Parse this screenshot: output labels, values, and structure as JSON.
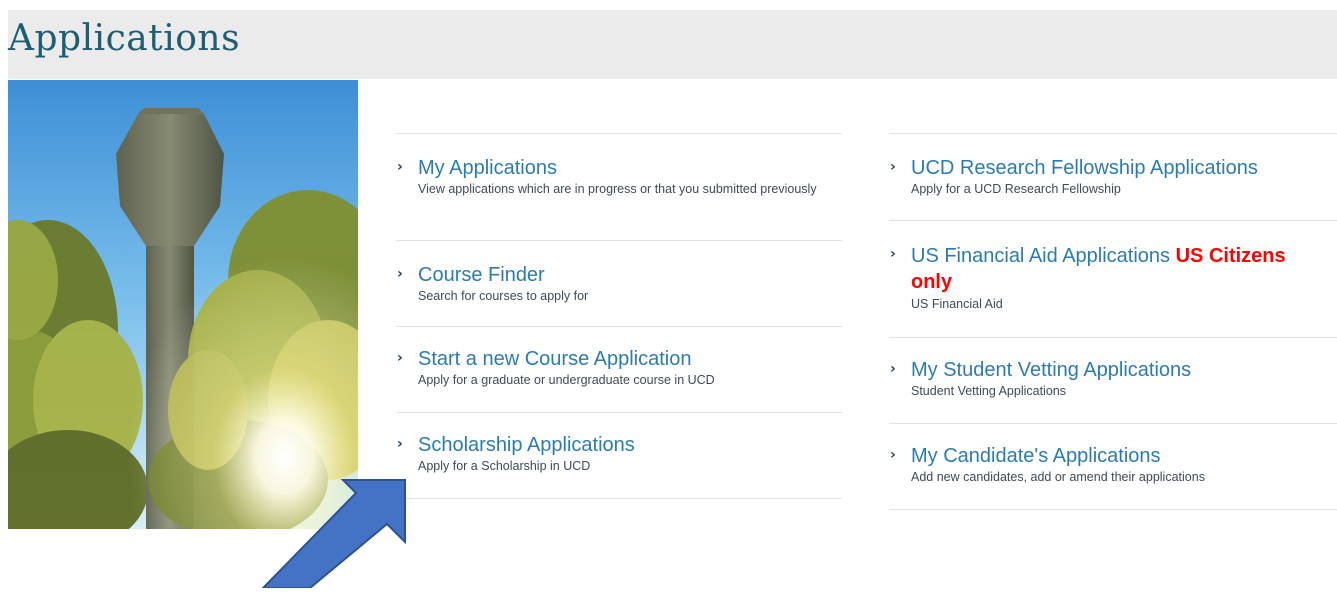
{
  "page": {
    "title": "Applications"
  },
  "left_links": [
    {
      "title": "My Applications",
      "description": "View applications which are in progress or that you submitted previously"
    },
    {
      "title": "Course Finder",
      "description": "Search for courses to apply for"
    },
    {
      "title": "Start a new Course Application",
      "description": "Apply for a graduate or undergraduate course in UCD"
    },
    {
      "title": "Scholarship Applications",
      "description": "Apply for a Scholarship in UCD"
    }
  ],
  "right_links": [
    {
      "title": "UCD Research Fellowship Applications",
      "description": "Apply for a UCD Research Fellowship"
    },
    {
      "title": "US Financial Aid Applications",
      "title_highlight": "US Citizens only",
      "description": "US Financial Aid"
    },
    {
      "title": "My Student Vetting Applications",
      "description": "Student Vetting Applications"
    },
    {
      "title": "My Candidate's Applications",
      "description": "Add new candidates, add or amend their applications"
    }
  ],
  "icons": {
    "link_chevron": "chevron-right-icon",
    "annotation": "arrow-pointer-icon"
  },
  "colors": {
    "header_bg": "#ebebeb",
    "title": "#1e5e74",
    "link": "#2c7bb0",
    "highlight": "#ff0000",
    "arrow": "#4472c4"
  }
}
